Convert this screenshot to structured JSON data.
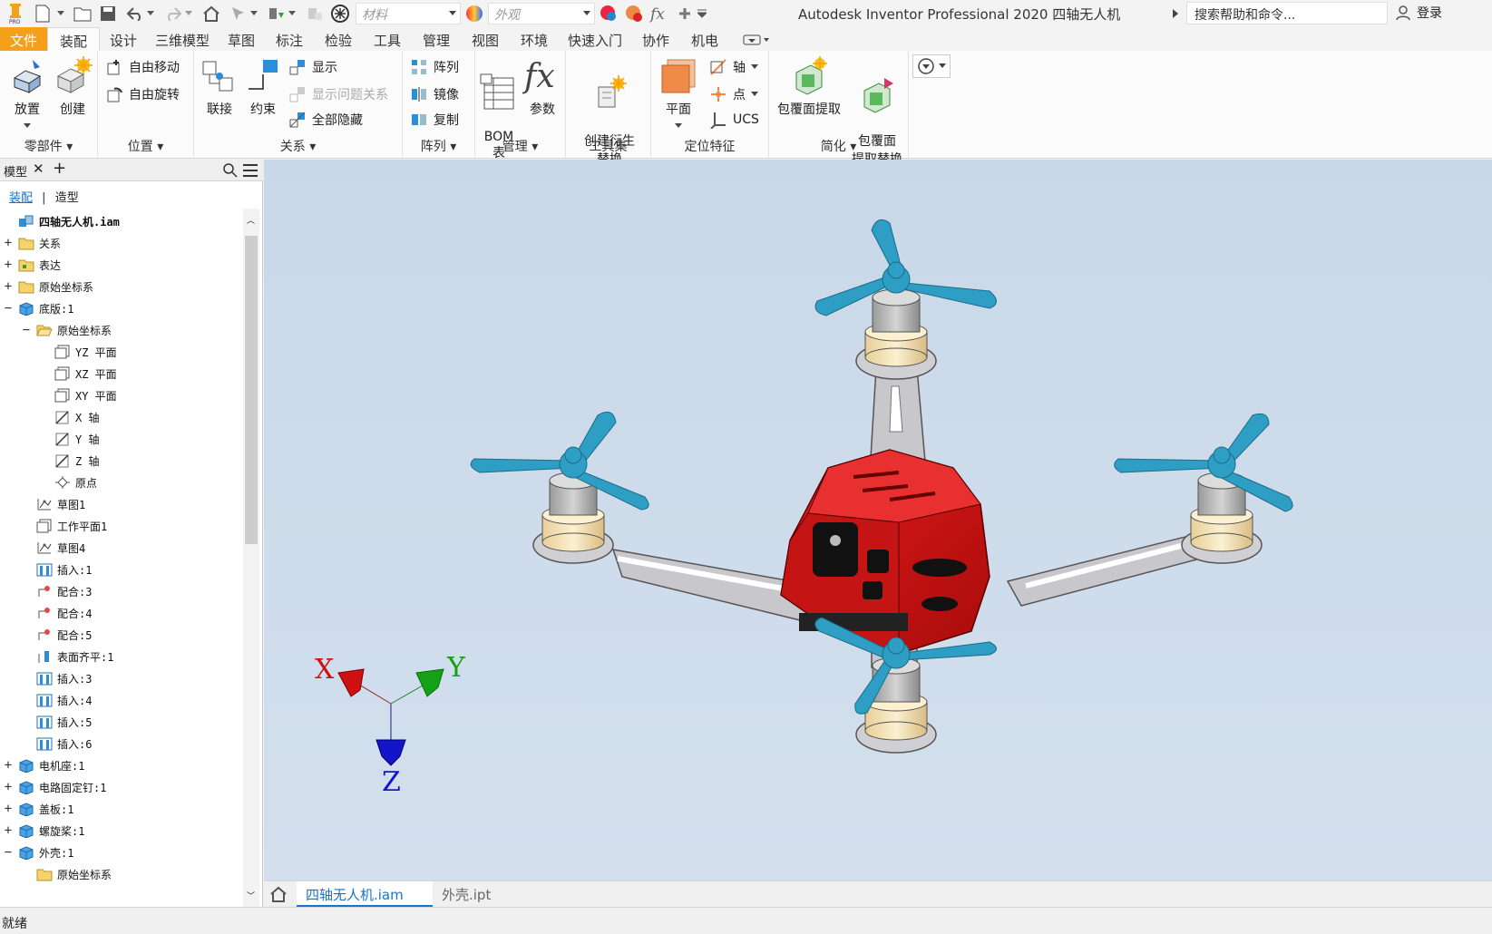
{
  "qat": {
    "material_placeholder": "材料",
    "appearance_placeholder": "外观",
    "title": "Autodesk Inventor Professional 2020    四轴无人机",
    "search_placeholder": "搜索帮助和命令...",
    "login": "登录"
  },
  "tabs": [
    "文件",
    "装配",
    "设计",
    "三维模型",
    "草图",
    "标注",
    "检验",
    "工具",
    "管理",
    "视图",
    "环境",
    "快速入门",
    "协作",
    "机电"
  ],
  "ribbon": {
    "components": {
      "title": "零部件",
      "place": "放置",
      "create": "创建"
    },
    "position": {
      "title": "位置",
      "free_move": "自由移动",
      "free_rotate": "自由旋转"
    },
    "relationships": {
      "title": "关系",
      "joint": "联接",
      "constrain": "约束",
      "show": "显示",
      "show_sick": "显示问题关系",
      "hide_all": "全部隐藏"
    },
    "pattern": {
      "title": "阵列",
      "pattern": "阵列",
      "mirror": "镜像",
      "copy": "复制"
    },
    "manage": {
      "title": "管理",
      "bom": "BOM\n表",
      "params": "参数"
    },
    "productivity": {
      "title": "工具集",
      "derive": "创建衍生\n替换"
    },
    "work_features": {
      "title": "定位特征",
      "plane": "平面",
      "axis": "轴",
      "point": "点",
      "ucs": "UCS"
    },
    "simplify": {
      "title": "简化",
      "shrinkwrap": "包覆面提取",
      "shrinkwrap_sub": "包覆面\n提取替换"
    }
  },
  "browser": {
    "tab": "模型",
    "sub_assembly": "装配",
    "sub_modeling": "造型",
    "tree": [
      {
        "label": "四轴无人机.iam",
        "level": 0,
        "exp": "",
        "icon": "assembly-icon",
        "bold": true
      },
      {
        "label": "关系",
        "level": 0,
        "exp": "+",
        "icon": "folder-icon"
      },
      {
        "label": "表达",
        "level": 0,
        "exp": "+",
        "icon": "representation-icon"
      },
      {
        "label": "原始坐标系",
        "level": 0,
        "exp": "+",
        "icon": "folder-icon"
      },
      {
        "label": "底版:1",
        "level": 0,
        "exp": "−",
        "icon": "part-icon"
      },
      {
        "label": "原始坐标系",
        "level": 1,
        "exp": "−",
        "icon": "folder-open-icon"
      },
      {
        "label": "YZ 平面",
        "level": 2,
        "exp": "",
        "icon": "plane-icon"
      },
      {
        "label": "XZ 平面",
        "level": 2,
        "exp": "",
        "icon": "plane-icon"
      },
      {
        "label": "XY 平面",
        "level": 2,
        "exp": "",
        "icon": "plane-icon"
      },
      {
        "label": "X 轴",
        "level": 2,
        "exp": "",
        "icon": "axis-icon"
      },
      {
        "label": "Y 轴",
        "level": 2,
        "exp": "",
        "icon": "axis-icon"
      },
      {
        "label": "Z 轴",
        "level": 2,
        "exp": "",
        "icon": "axis-icon"
      },
      {
        "label": "原点",
        "level": 2,
        "exp": "",
        "icon": "point-icon"
      },
      {
        "label": "草图1",
        "level": 1,
        "exp": "",
        "icon": "sketch-icon"
      },
      {
        "label": "工作平面1",
        "level": 1,
        "exp": "",
        "icon": "plane-icon"
      },
      {
        "label": "草图4",
        "level": 1,
        "exp": "",
        "icon": "sketch-icon"
      },
      {
        "label": "插入:1",
        "level": 1,
        "exp": "",
        "icon": "insert-icon"
      },
      {
        "label": "配合:3",
        "level": 1,
        "exp": "",
        "icon": "mate-icon"
      },
      {
        "label": "配合:4",
        "level": 1,
        "exp": "",
        "icon": "mate-icon"
      },
      {
        "label": "配合:5",
        "level": 1,
        "exp": "",
        "icon": "mate-icon"
      },
      {
        "label": "表面齐平:1",
        "level": 1,
        "exp": "",
        "icon": "flush-icon"
      },
      {
        "label": "插入:3",
        "level": 1,
        "exp": "",
        "icon": "insert-icon"
      },
      {
        "label": "插入:4",
        "level": 1,
        "exp": "",
        "icon": "insert-icon"
      },
      {
        "label": "插入:5",
        "level": 1,
        "exp": "",
        "icon": "insert-icon"
      },
      {
        "label": "插入:6",
        "level": 1,
        "exp": "",
        "icon": "insert-icon"
      },
      {
        "label": "电机座:1",
        "level": 0,
        "exp": "+",
        "icon": "part-icon"
      },
      {
        "label": "电路固定钉:1",
        "level": 0,
        "exp": "+",
        "icon": "part-icon"
      },
      {
        "label": "盖板:1",
        "level": 0,
        "exp": "+",
        "icon": "part-icon"
      },
      {
        "label": "螺旋桨:1",
        "level": 0,
        "exp": "+",
        "icon": "part-icon"
      },
      {
        "label": "外壳:1",
        "level": 0,
        "exp": "−",
        "icon": "part-icon"
      },
      {
        "label": "原始坐标系",
        "level": 1,
        "exp": "",
        "icon": "folder-icon"
      }
    ]
  },
  "viewport": {
    "axis_x": "X",
    "axis_y": "Y",
    "axis_z": "Z"
  },
  "doc_tabs": {
    "active": "四轴无人机.iam",
    "other": "外壳.ipt"
  },
  "status": "就绪",
  "colors": {
    "file_tab": "#f5a01a",
    "shell_red": "#d21414",
    "propeller": "#2e9ec4",
    "viewport_bg": "#cddbe9"
  }
}
